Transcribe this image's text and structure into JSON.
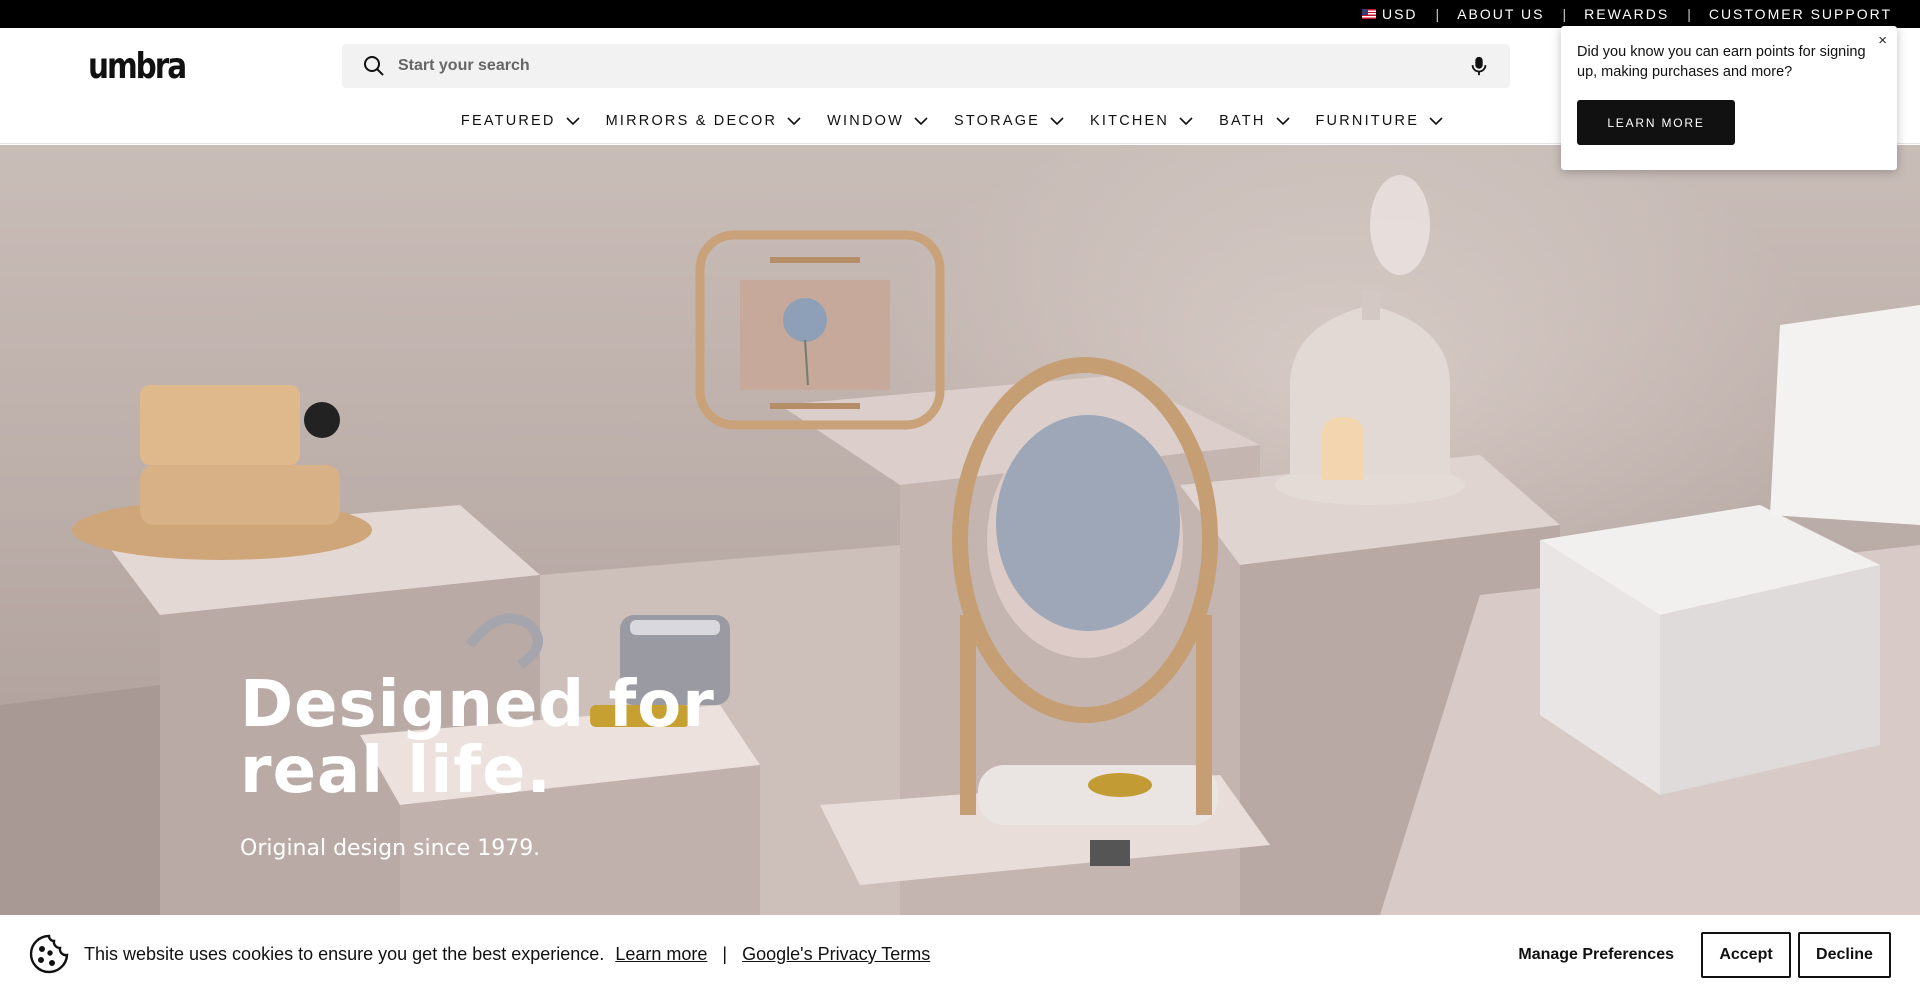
{
  "utility_bar": {
    "currency": "USD",
    "about": "ABOUT US",
    "rewards": "REWARDS",
    "support": "CUSTOMER SUPPORT",
    "separator": "|"
  },
  "header": {
    "logo": "umbra",
    "search_placeholder": "Start your search"
  },
  "nav": {
    "items": [
      {
        "label": "FEATURED"
      },
      {
        "label": "MIRRORS & DECOR"
      },
      {
        "label": "WINDOW"
      },
      {
        "label": "STORAGE"
      },
      {
        "label": "KITCHEN"
      },
      {
        "label": "BATH"
      },
      {
        "label": "FURNITURE"
      }
    ]
  },
  "hero": {
    "title": "Designed for\nreal life.",
    "subtitle": "Original design since 1979."
  },
  "popup": {
    "message": "Did you know you can earn points for signing up, making purchases and more?",
    "button": "LEARN MORE",
    "close": "×"
  },
  "cookie": {
    "text": "This website uses cookies to ensure you get the best experience.",
    "learn_more": "Learn more",
    "separator": "|",
    "privacy": "Google's Privacy Terms",
    "manage": "Manage Preferences",
    "accept": "Accept",
    "decline": "Decline"
  },
  "icons": {
    "search": "search-icon",
    "mic": "microphone-icon",
    "chevron": "chevron-down-icon",
    "flag": "us-flag-icon",
    "cookie": "cookie-icon"
  }
}
